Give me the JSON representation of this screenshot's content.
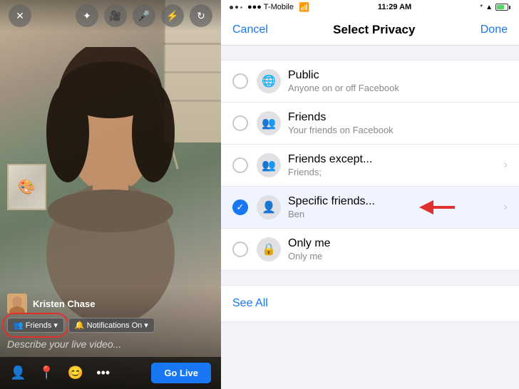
{
  "left": {
    "user_name": "Kristen Chase",
    "describe_placeholder": "Describe your live video...",
    "friends_btn": "Friends",
    "notifications_btn": "Notifications On",
    "go_live_btn": "Go Live"
  },
  "right": {
    "status_bar": {
      "carrier": "●●● T-Mobile",
      "wifi": "▼",
      "time": "11:29 AM",
      "bluetooth": "✦",
      "battery_text": "■"
    },
    "nav": {
      "cancel": "Cancel",
      "title": "Select Privacy",
      "done": "Done"
    },
    "privacy_options": [
      {
        "id": "public",
        "name": "Public",
        "desc": "Anyone on or off Facebook",
        "icon": "🌐",
        "selected": false,
        "has_chevron": false
      },
      {
        "id": "friends",
        "name": "Friends",
        "desc": "Your friends on Facebook",
        "icon": "👥",
        "selected": false,
        "has_chevron": false
      },
      {
        "id": "friends-except",
        "name": "Friends except...",
        "desc": "Friends;",
        "icon": "👥",
        "selected": false,
        "has_chevron": true
      },
      {
        "id": "specific-friends",
        "name": "Specific friends...",
        "desc": "Ben",
        "icon": "👤",
        "selected": true,
        "has_chevron": true,
        "has_arrow": true
      },
      {
        "id": "only-me",
        "name": "Only me",
        "desc": "Only me",
        "icon": "🔒",
        "selected": false,
        "has_chevron": false
      }
    ],
    "see_all": "See All"
  }
}
